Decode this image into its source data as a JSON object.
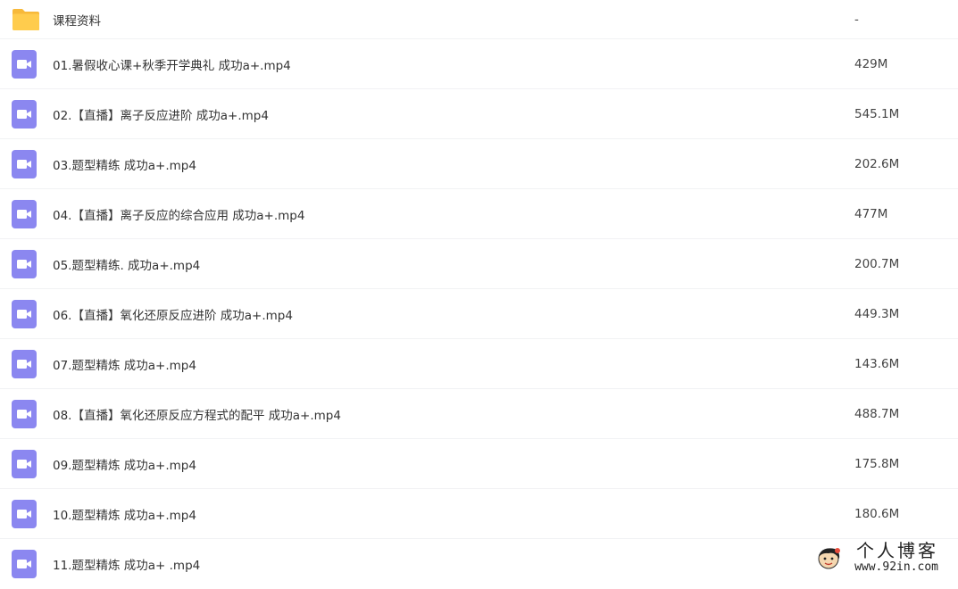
{
  "files": [
    {
      "type": "folder",
      "name": "课程资料",
      "size": "-"
    },
    {
      "type": "video",
      "name": "01.暑假收心课+秋季开学典礼 成功a+.mp4",
      "size": "429M"
    },
    {
      "type": "video",
      "name": "02.【直播】离子反应进阶 成功a+.mp4",
      "size": "545.1M"
    },
    {
      "type": "video",
      "name": "03.题型精练 成功a+.mp4",
      "size": "202.6M"
    },
    {
      "type": "video",
      "name": "04.【直播】离子反应的综合应用 成功a+.mp4",
      "size": "477M"
    },
    {
      "type": "video",
      "name": "05.题型精练. 成功a+.mp4",
      "size": "200.7M"
    },
    {
      "type": "video",
      "name": "06.【直播】氧化还原反应进阶 成功a+.mp4",
      "size": "449.3M"
    },
    {
      "type": "video",
      "name": "07.题型精炼 成功a+.mp4",
      "size": "143.6M"
    },
    {
      "type": "video",
      "name": "08.【直播】氧化还原反应方程式的配平 成功a+.mp4",
      "size": "488.7M"
    },
    {
      "type": "video",
      "name": "09.题型精炼 成功a+.mp4",
      "size": "175.8M"
    },
    {
      "type": "video",
      "name": "10.题型精炼 成功a+.mp4",
      "size": "180.6M"
    },
    {
      "type": "video",
      "name": "11.题型精炼 成功a+ .mp4",
      "size": ""
    }
  ],
  "watermark": {
    "title": "个人博客",
    "url": "www.92in.com"
  },
  "colors": {
    "folder": "#ffc94a",
    "video": "#8b87f0",
    "divider": "#f1f2f4"
  },
  "icons": {
    "folder": "folder-icon",
    "video": "video-file-icon"
  }
}
